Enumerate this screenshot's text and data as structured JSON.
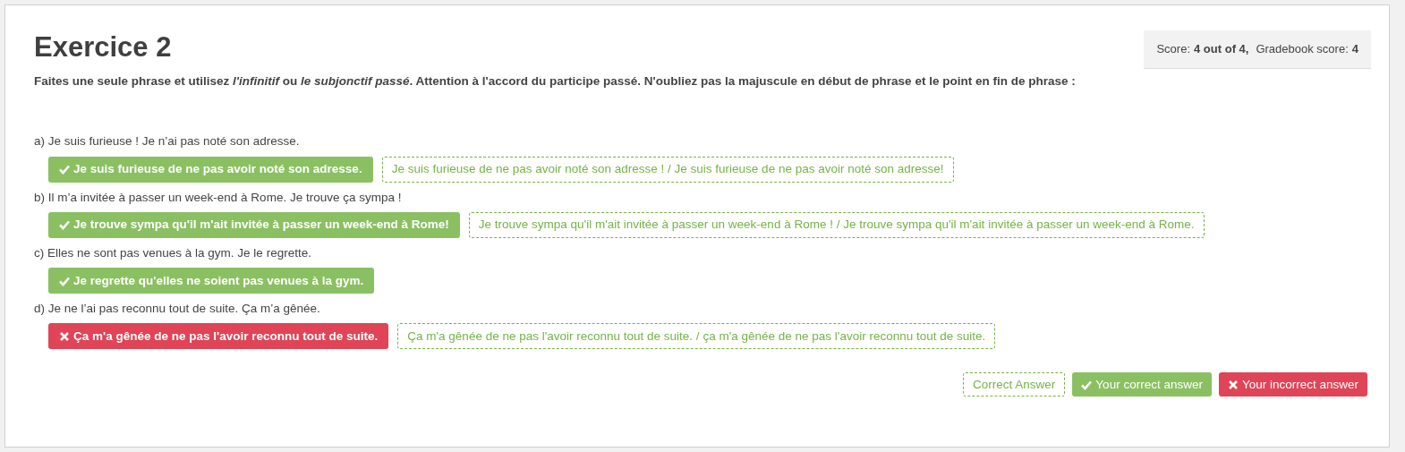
{
  "title": "Exercice 2",
  "instructions": "Faites une seule phrase et utilisez *l'infinitif* ou *le subjonctif passé*. Attention à l'accord du participe passé. N'oubliez pas la majuscule en début de phrase et le point en fin de phrase :",
  "score": {
    "label": "Score:",
    "value": "4 out of 4,",
    "gradebook_label": "Gradebook score:",
    "gradebook_value": "4"
  },
  "questions": [
    {
      "prompt": "a) Je suis furieuse ! Je n’ai pas noté son adresse.",
      "answer": "Je suis furieuse de ne pas avoir noté son adresse.",
      "correct": true,
      "expected": "Je suis furieuse de ne pas avoir noté son adresse ! / Je suis furieuse de ne pas avoir noté son adresse!"
    },
    {
      "prompt": "b) Il m’a invitée à passer un week-end à Rome. Je trouve ça sympa !",
      "answer": "Je trouve sympa qu'il m'ait invitée à passer un week-end à Rome!",
      "correct": true,
      "expected": "Je trouve sympa qu'il m'ait invitée à passer un week-end à Rome ! / Je trouve sympa qu'il m'ait invitée à passer un week-end à Rome."
    },
    {
      "prompt": "c) Elles ne sont pas venues à la gym. Je le regrette.",
      "answer": "Je regrette qu'elles ne soient pas venues à la gym.",
      "correct": true
    },
    {
      "prompt": "d) Je ne l’ai pas reconnu tout de suite. Ça m’a gênée.",
      "answer": "Ça m'a gênée de ne pas l'avoir reconnu tout de suite.",
      "correct": false,
      "expected": "Ça m'a gênée de ne pas l'avoir reconnu tout de suite. / ça m'a gênée de ne pas l'avoir reconnu tout de suite."
    }
  ],
  "legend": [
    {
      "kind": "expected",
      "text": "Correct Answer"
    },
    {
      "kind": "correct",
      "text": "Your correct answer"
    },
    {
      "kind": "incorrect",
      "text": "Your incorrect answer"
    }
  ]
}
